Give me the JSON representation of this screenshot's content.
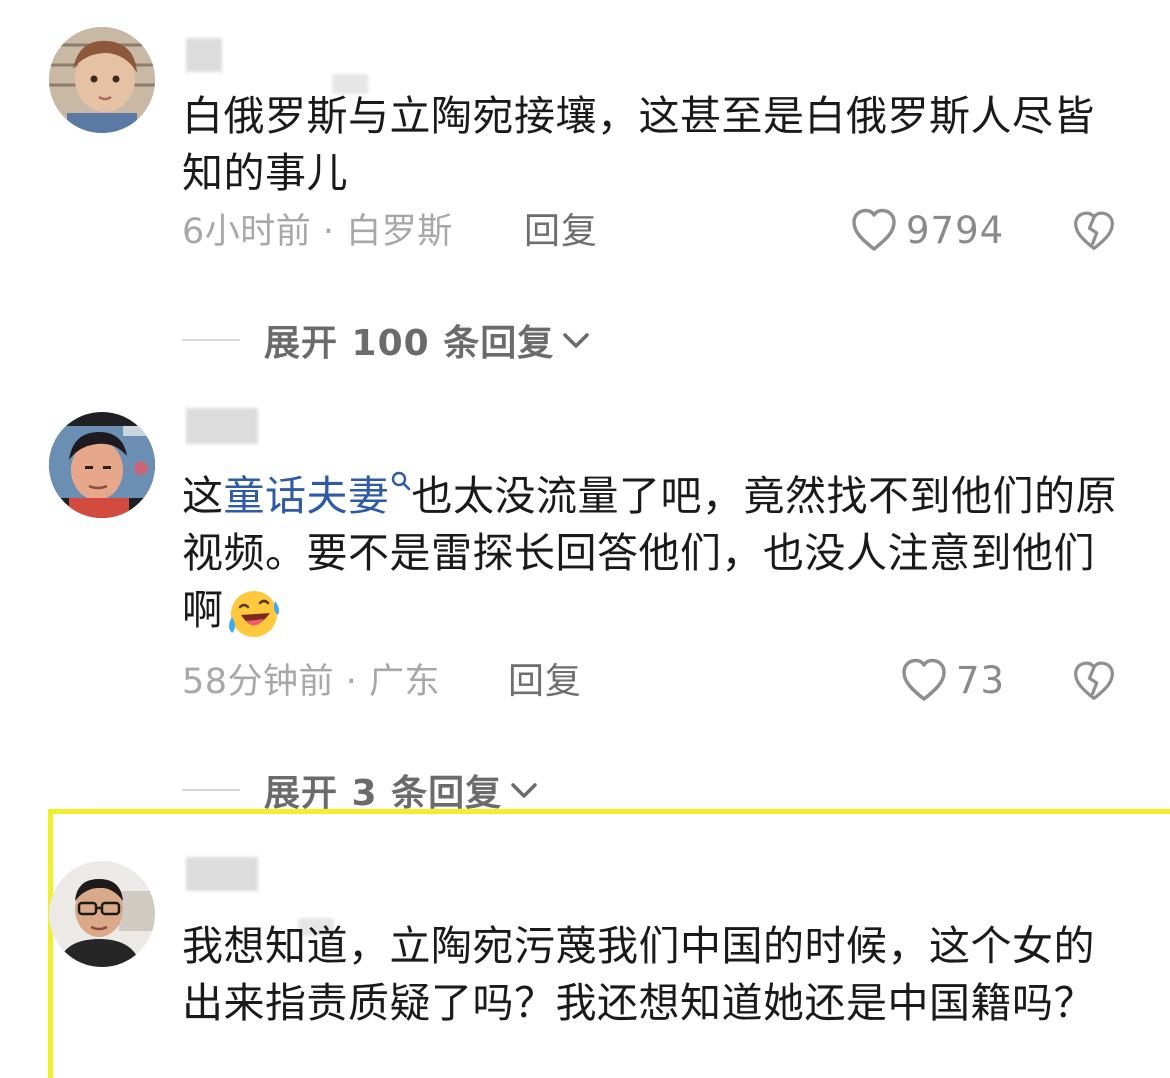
{
  "comments": [
    {
      "text": "白俄罗斯与立陶宛接壤，这甚至是白俄罗斯人尽皆知的事儿",
      "time": "6小时前",
      "dot": "·",
      "location": "白罗斯",
      "reply_label": "回复",
      "likes": "9794",
      "expand_label": "展开 100 条回复"
    },
    {
      "text_before": "这",
      "link_text": "童话夫妻",
      "text_after": "也太没流量了吧，竟然找不到他们的原视频。要不是雷探长回答他们，也没人注意到他们啊",
      "emoji": "laughing-crying-emoji",
      "time": "58分钟前",
      "dot": "·",
      "location": "广东",
      "reply_label": "回复",
      "likes": "73",
      "expand_label": "展开 3 条回复"
    },
    {
      "text": "我想知道，立陶宛污蔑我们中国的时候，这个女的出来指责质疑了吗？我还想知道她还是中国籍吗？",
      "highlight_color": "#f0f02a"
    }
  ],
  "icons": {
    "like": "heart-outline-icon",
    "dislike": "broken-heart-icon",
    "expand": "chevron-down-icon",
    "search": "search-icon"
  }
}
